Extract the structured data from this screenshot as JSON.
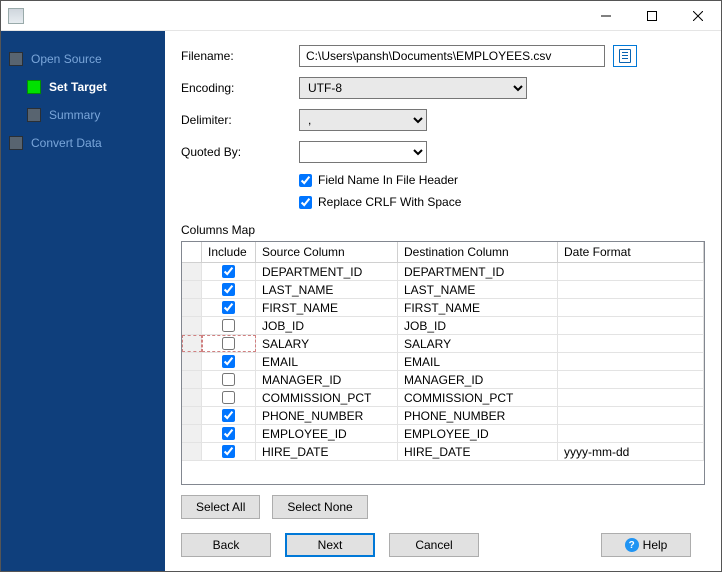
{
  "window": {
    "title": ""
  },
  "sidebar": {
    "items": [
      {
        "label": "Open Source",
        "active": false
      },
      {
        "label": "Set Target",
        "active": true,
        "child": true
      },
      {
        "label": "Summary",
        "active": false,
        "child": true
      },
      {
        "label": "Convert Data",
        "active": false
      }
    ]
  },
  "form": {
    "filename_label": "Filename:",
    "filename_value": "C:\\Users\\pansh\\Documents\\EMPLOYEES.csv",
    "encoding_label": "Encoding:",
    "encoding_value": "UTF-8",
    "delimiter_label": "Delimiter:",
    "delimiter_value": ",",
    "quoted_label": "Quoted By:",
    "quoted_value": "",
    "chk_header_label": "Field Name In File Header",
    "chk_header_checked": true,
    "chk_crlf_label": "Replace CRLF With Space",
    "chk_crlf_checked": true
  },
  "columns_map": {
    "title": "Columns Map",
    "headers": {
      "include": "Include",
      "source": "Source Column",
      "dest": "Destination Column",
      "date": "Date Format"
    },
    "rows": [
      {
        "include": true,
        "source": "DEPARTMENT_ID",
        "dest": "DEPARTMENT_ID",
        "date": ""
      },
      {
        "include": true,
        "source": "LAST_NAME",
        "dest": "LAST_NAME",
        "date": ""
      },
      {
        "include": true,
        "source": "FIRST_NAME",
        "dest": "FIRST_NAME",
        "date": ""
      },
      {
        "include": false,
        "source": "JOB_ID",
        "dest": "JOB_ID",
        "date": ""
      },
      {
        "include": false,
        "source": "SALARY",
        "dest": "SALARY",
        "date": "",
        "dashed": true
      },
      {
        "include": true,
        "source": "EMAIL",
        "dest": "EMAIL",
        "date": ""
      },
      {
        "include": false,
        "source": "MANAGER_ID",
        "dest": "MANAGER_ID",
        "date": ""
      },
      {
        "include": false,
        "source": "COMMISSION_PCT",
        "dest": "COMMISSION_PCT",
        "date": ""
      },
      {
        "include": true,
        "source": "PHONE_NUMBER",
        "dest": "PHONE_NUMBER",
        "date": ""
      },
      {
        "include": true,
        "source": "EMPLOYEE_ID",
        "dest": "EMPLOYEE_ID",
        "date": ""
      },
      {
        "include": true,
        "source": "HIRE_DATE",
        "dest": "HIRE_DATE",
        "date": "yyyy-mm-dd"
      }
    ]
  },
  "buttons": {
    "select_all": "Select All",
    "select_none": "Select None",
    "back": "Back",
    "next": "Next",
    "cancel": "Cancel",
    "help": "Help"
  }
}
